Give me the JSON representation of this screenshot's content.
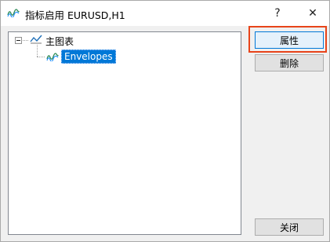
{
  "window": {
    "title": "指标启用 EURUSD,H1",
    "title_icon": "indicator-wave-icon",
    "help_symbol": "?",
    "close_symbol": "✕"
  },
  "tree": {
    "root": {
      "label": "主图表",
      "icon": "line-chart-icon",
      "expanded": true
    },
    "children": [
      {
        "label": "Envelopes",
        "icon": "indicator-wave-icon",
        "selected": true
      }
    ]
  },
  "buttons": {
    "properties": "属性",
    "delete": "删除",
    "close": "关闭"
  },
  "colors": {
    "selection": "#0078d7",
    "highlight_box": "#e8441a",
    "indicator_icon": "#2e8b57"
  }
}
